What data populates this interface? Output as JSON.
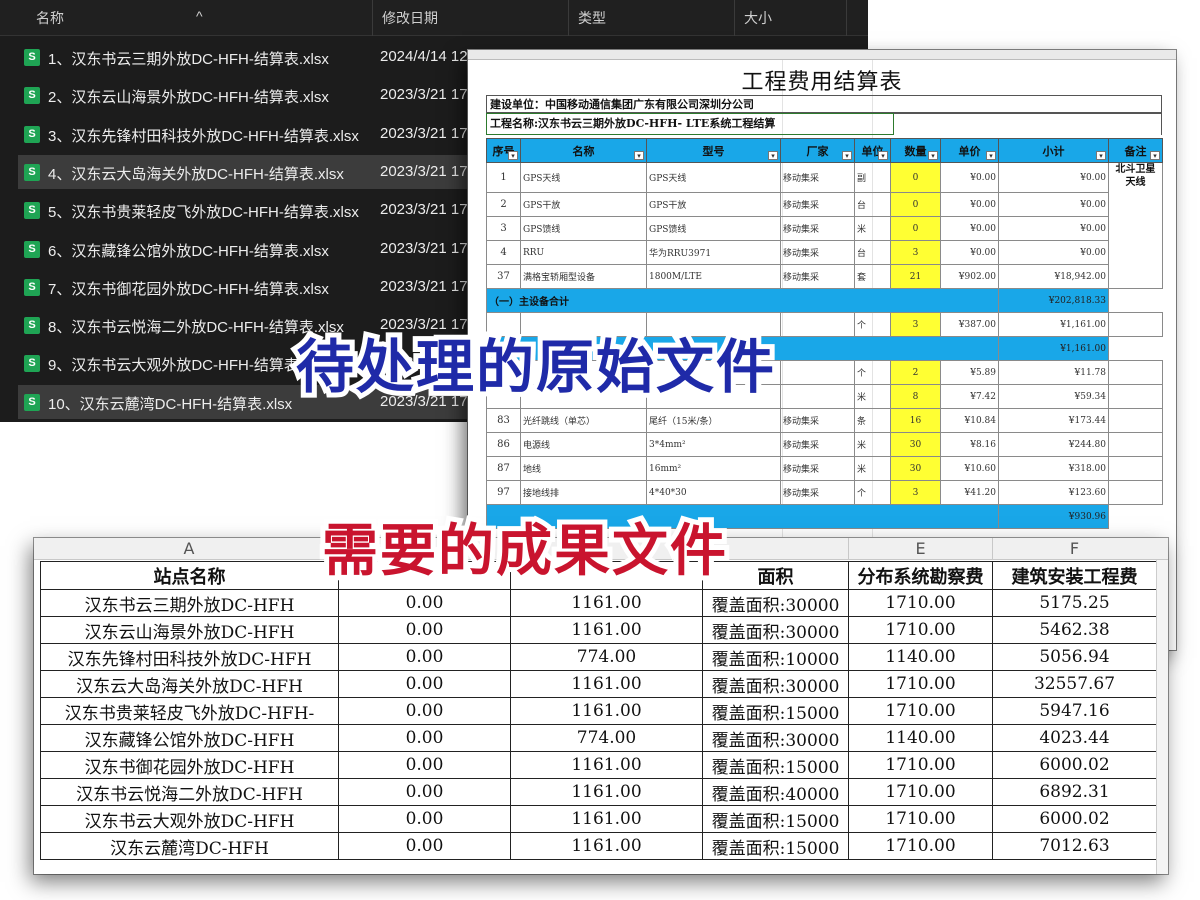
{
  "explorer": {
    "columns": {
      "name": "名称",
      "modified": "修改日期",
      "type": "类型",
      "size": "大小"
    },
    "files": [
      {
        "name": "1、汉东书云三期外放DC-HFH-结算表.xlsx",
        "date": "2024/4/14 12:",
        "icon": "excel-file-icon"
      },
      {
        "name": "2、汉东云山海景外放DC-HFH-结算表.xlsx",
        "date": "2023/3/21 17:",
        "icon": "excel-file-icon"
      },
      {
        "name": "3、汉东先锋村田科技外放DC-HFH-结算表.xlsx",
        "date": "2023/3/21 17:",
        "icon": "excel-file-icon"
      },
      {
        "name": "4、汉东云大岛海关外放DC-HFH-结算表.xlsx",
        "date": "2023/3/21 17:",
        "icon": "excel-file-icon",
        "selected": true
      },
      {
        "name": "5、汉东书贵莱轻皮飞外放DC-HFH-结算表.xlsx",
        "date": "2023/3/21 17:",
        "icon": "excel-file-icon"
      },
      {
        "name": "6、汉东藏锋公馆外放DC-HFH-结算表.xlsx",
        "date": "2023/3/21 17:",
        "icon": "excel-file-icon"
      },
      {
        "name": "7、汉东书御花园外放DC-HFH-结算表.xlsx",
        "date": "2023/3/21 17:",
        "icon": "excel-file-icon"
      },
      {
        "name": "8、汉东书云悦海二外放DC-HFH-结算表.xlsx",
        "date": "2023/3/21 17:",
        "icon": "excel-file-icon"
      },
      {
        "name": "9、汉东书云大观外放DC-HFH-结算表.xlsx",
        "date": "2023/3/21 17:",
        "icon": "excel-file-icon"
      },
      {
        "name": "10、汉东云麓湾DC-HFH-结算表.xlsx",
        "date": "2023/3/21 17:",
        "icon": "excel-file-icon",
        "selected": true
      }
    ]
  },
  "settlement": {
    "title": "工程费用结算表",
    "unit": "建设单位：中国移动通信集团广东有限公司深圳分公司",
    "project": "工程名称:汉东书云三期外放DC-HFH- LTE系统工程结算",
    "headers": [
      "序号",
      "名称",
      "型号",
      "厂家",
      "单位",
      "数量",
      "单价",
      "小计",
      "备注"
    ],
    "remark": "北斗卫星天线",
    "rows": [
      {
        "seq": "1",
        "name": "GPS天线",
        "model": "GPS天线",
        "maker": "移动集采",
        "unit": "副",
        "qty": "0",
        "price": "¥0.00",
        "subtotal": "¥0.00"
      },
      {
        "seq": "2",
        "name": "GPS干放",
        "model": "GPS干放",
        "maker": "移动集采",
        "unit": "台",
        "qty": "0",
        "price": "¥0.00",
        "subtotal": "¥0.00"
      },
      {
        "seq": "3",
        "name": "GPS馈线",
        "model": "GPS馈线",
        "maker": "移动集采",
        "unit": "米",
        "qty": "0",
        "price": "¥0.00",
        "subtotal": "¥0.00"
      },
      {
        "seq": "4",
        "name": "RRU",
        "model": "华为RRU3971",
        "maker": "移动集采",
        "unit": "台",
        "qty": "3",
        "price": "¥0.00",
        "subtotal": "¥0.00"
      },
      {
        "seq": "37",
        "name": "满格宝轿厢型设备",
        "model": "1800M/LTE",
        "maker": "移动集采",
        "unit": "套",
        "qty": "21",
        "price": "¥902.00",
        "subtotal": "¥18,942.00"
      },
      {
        "total": true,
        "label": "（一）主设备合计",
        "subtotal": "¥202,818.33"
      },
      {
        "seq": "",
        "name": "",
        "model": "",
        "maker": "",
        "unit": "个",
        "qty": "3",
        "price": "¥387.00",
        "subtotal": "¥1,161.00"
      },
      {
        "total": true,
        "label": "",
        "subtotal": "¥1,161.00"
      },
      {
        "seq": "",
        "name": "",
        "model": "",
        "maker": "",
        "unit": "个",
        "qty": "2",
        "price": "¥5.89",
        "subtotal": "¥11.78"
      },
      {
        "seq": "",
        "name": "",
        "model": "",
        "maker": "",
        "unit": "米",
        "qty": "8",
        "price": "¥7.42",
        "subtotal": "¥59.34"
      },
      {
        "seq": "83",
        "name": "光纤跳线（单芯）",
        "model": "尾纤（15米/条）",
        "maker": "移动集采",
        "unit": "条",
        "qty": "16",
        "price": "¥10.84",
        "subtotal": "¥173.44"
      },
      {
        "seq": "86",
        "name": "电源线",
        "model": "3*4mm²",
        "maker": "移动集采",
        "unit": "米",
        "qty": "30",
        "price": "¥8.16",
        "subtotal": "¥244.80"
      },
      {
        "seq": "87",
        "name": "地线",
        "model": "16mm²",
        "maker": "移动集采",
        "unit": "米",
        "qty": "30",
        "price": "¥10.60",
        "subtotal": "¥318.00"
      },
      {
        "seq": "97",
        "name": "接地线排",
        "model": "4*40*30",
        "maker": "移动集采",
        "unit": "个",
        "qty": "3",
        "price": "¥41.20",
        "subtotal": "¥123.60"
      },
      {
        "total": true,
        "label": "",
        "subtotal": "¥930.96"
      }
    ]
  },
  "result": {
    "col_letters": [
      "A",
      "E",
      "F"
    ],
    "headers": [
      "站点名称",
      "",
      "",
      "面积",
      "分布系统勘察费",
      "建筑安装工程费"
    ],
    "rows": [
      [
        "汉东书云三期外放DC-HFH",
        "0.00",
        "1161.00",
        "覆盖面积:30000",
        "1710.00",
        "5175.25"
      ],
      [
        "汉东云山海景外放DC-HFH",
        "0.00",
        "1161.00",
        "覆盖面积:30000",
        "1710.00",
        "5462.38"
      ],
      [
        "汉东先锋村田科技外放DC-HFH",
        "0.00",
        "774.00",
        "覆盖面积:10000",
        "1140.00",
        "5056.94"
      ],
      [
        "汉东云大岛海关外放DC-HFH",
        "0.00",
        "1161.00",
        "覆盖面积:30000",
        "1710.00",
        "32557.67"
      ],
      [
        "汉东书贵莱轻皮飞外放DC-HFH-",
        "0.00",
        "1161.00",
        "覆盖面积:15000",
        "1710.00",
        "5947.16"
      ],
      [
        "汉东藏锋公馆外放DC-HFH",
        "0.00",
        "774.00",
        "覆盖面积:30000",
        "1140.00",
        "4023.44"
      ],
      [
        "汉东书御花园外放DC-HFH",
        "0.00",
        "1161.00",
        "覆盖面积:15000",
        "1710.00",
        "6000.02"
      ],
      [
        "汉东书云悦海二外放DC-HFH",
        "0.00",
        "1161.00",
        "覆盖面积:40000",
        "1710.00",
        "6892.31"
      ],
      [
        "汉东书云大观外放DC-HFH",
        "0.00",
        "1161.00",
        "覆盖面积:15000",
        "1710.00",
        "6000.02"
      ],
      [
        "汉东云麓湾DC-HFH",
        "0.00",
        "1161.00",
        "覆盖面积:15000",
        "1710.00",
        "7012.63"
      ]
    ]
  },
  "captions": {
    "raw": "待处理的原始文件",
    "output": "需要的成果文件"
  },
  "colors": {
    "raw_caption": "#1f2aa8",
    "output_caption": "#c9142e",
    "sheet_header": "#19a7e8",
    "qty_highlight": "#ffff33",
    "excel_icon": "#1fa454"
  }
}
